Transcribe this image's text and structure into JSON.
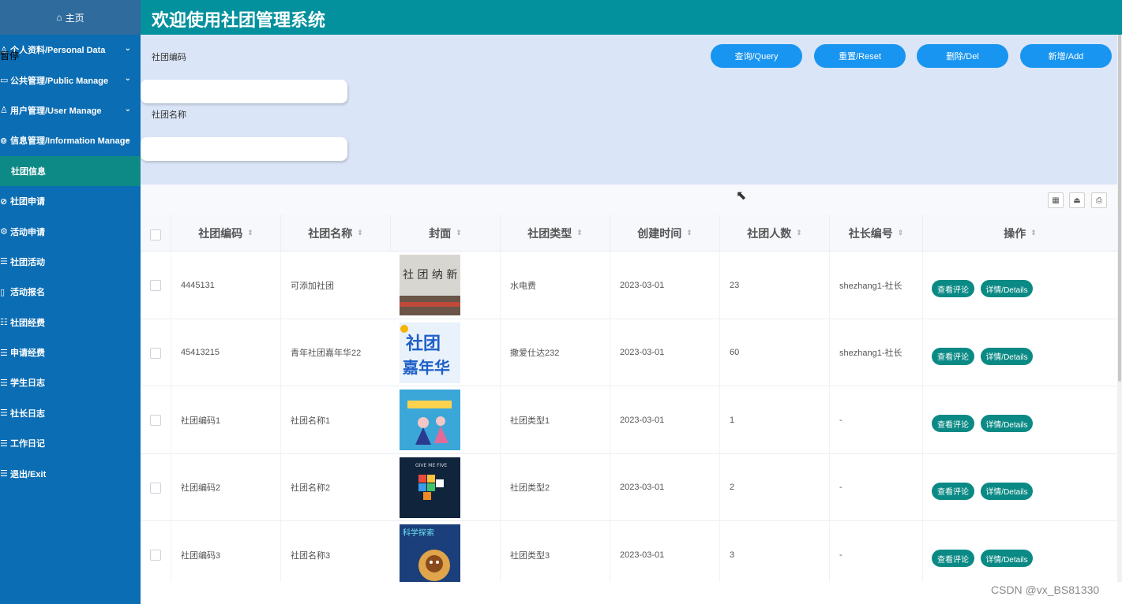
{
  "sidebar": {
    "home": "主页",
    "pause_overlay": "暂停",
    "items": [
      {
        "label": "个人资料/Personal Data",
        "icon": "user-icon",
        "expand": true
      },
      {
        "label": "公共管理/Public Manage",
        "icon": "monitor-icon",
        "expand": true
      },
      {
        "label": "用户管理/User Manage",
        "icon": "users-icon",
        "expand": true
      },
      {
        "label": "信息管理/Information Manage",
        "icon": "settings-icon",
        "expand": true
      },
      {
        "label": "社团信息",
        "icon": "",
        "expand": false,
        "active": true
      },
      {
        "label": "社团申请",
        "icon": "stamp-icon",
        "expand": false
      },
      {
        "label": "活动申请",
        "icon": "gear-icon",
        "expand": false
      },
      {
        "label": "社团活动",
        "icon": "list-icon",
        "expand": false
      },
      {
        "label": "活动报名",
        "icon": "book-icon",
        "expand": false
      },
      {
        "label": "社团经费",
        "icon": "ledger-icon",
        "expand": false
      },
      {
        "label": "申请经费",
        "icon": "form-icon",
        "expand": false
      },
      {
        "label": "学生日志",
        "icon": "form-icon",
        "expand": false
      },
      {
        "label": "社长日志",
        "icon": "form-icon",
        "expand": false
      },
      {
        "label": "工作日记",
        "icon": "form-icon",
        "expand": false
      },
      {
        "label": "退出/Exit",
        "icon": "exit-icon",
        "expand": false
      }
    ]
  },
  "header": {
    "title": "欢迎使用社团管理系统"
  },
  "search": {
    "code_label": "社团编码",
    "code_value": "",
    "name_label": "社团名称",
    "name_value": "",
    "buttons": {
      "query": "查询/Query",
      "reset": "重置/Reset",
      "delete": "删除/Del",
      "add": "新增/Add"
    }
  },
  "table": {
    "columns": [
      "社团编码",
      "社团名称",
      "封面",
      "社团类型",
      "创建时间",
      "社团人数",
      "社长编号",
      "操作"
    ],
    "rows": [
      {
        "code": "4445131",
        "name": "可添加社团",
        "cover": "社团纳新 poster",
        "type": "水电费",
        "created": "2023-03-01",
        "members": "23",
        "leader": "shezhang1-社长"
      },
      {
        "code": "45413215",
        "name": "青年社团嘉年华22",
        "cover": "社团嘉年华 poster",
        "type": "撒爱仕达232",
        "created": "2023-03-01",
        "members": "60",
        "leader": "shezhang1-社长"
      },
      {
        "code": "社团编码1",
        "name": "社团名称1",
        "cover": "dance poster",
        "type": "社团类型1",
        "created": "2023-03-01",
        "members": "1",
        "leader": "-"
      },
      {
        "code": "社团编码2",
        "name": "社团名称2",
        "cover": "rubik cube poster",
        "type": "社团类型2",
        "created": "2023-03-01",
        "members": "2",
        "leader": "-"
      },
      {
        "code": "社团编码3",
        "name": "社团名称3",
        "cover": "science club poster",
        "type": "社团类型3",
        "created": "2023-03-01",
        "members": "3",
        "leader": "-"
      }
    ],
    "row_actions": {
      "comments": "查看评论",
      "details": "详情/Details"
    }
  },
  "watermark": "CSDN @vx_BS81330",
  "colors": {
    "sidebar": "#0b6db3",
    "sidebar_active": "#0e8a86",
    "header": "#03919e",
    "search_bg": "#dbe5f8",
    "primary_button": "#1895f0",
    "action_button": "#0b8a85"
  }
}
